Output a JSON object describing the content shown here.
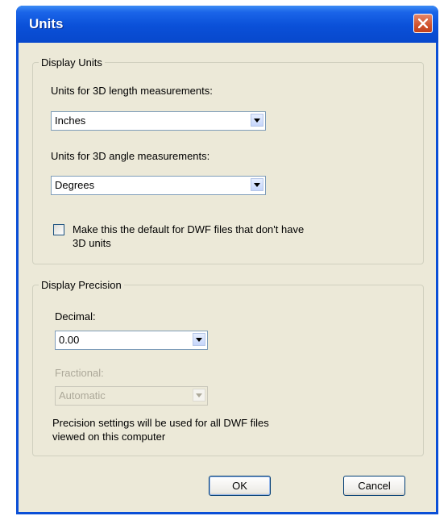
{
  "window": {
    "title": "Units"
  },
  "display_units": {
    "legend": "Display Units",
    "length_label": "Units for 3D length measurements:",
    "length_value": "Inches",
    "angle_label": "Units for 3D angle measurements:",
    "angle_value": "Degrees",
    "default_checkbox_label_line1": "Make this the default for DWF files that don't have",
    "default_checkbox_label_line2": "3D units",
    "default_checked": false
  },
  "display_precision": {
    "legend": "Display Precision",
    "decimal_label": "Decimal:",
    "decimal_value": "0.00",
    "fractional_label": "Fractional:",
    "fractional_value": "Automatic",
    "note_line1": "Precision settings will be used for all DWF files",
    "note_line2": "viewed on this computer"
  },
  "buttons": {
    "ok": "OK",
    "cancel": "Cancel"
  },
  "colors": {
    "titlebar": "#0a50d8",
    "dialog_bg": "#ece9d8",
    "close_button": "#d0532d",
    "disabled_text": "#aca899"
  }
}
